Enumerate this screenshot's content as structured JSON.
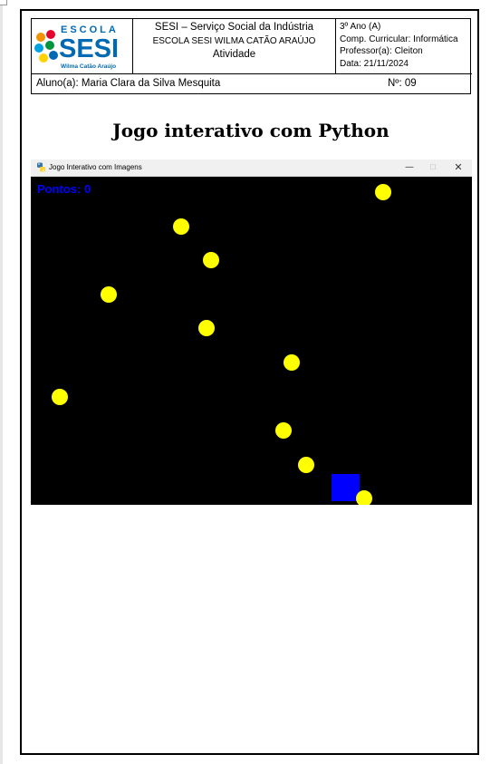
{
  "header": {
    "logo": {
      "brand_top": "ESCOLA",
      "brand_main": "SESI",
      "brand_sub": "Wilma Catão Araújo"
    },
    "institution": "SESI – Serviço Social da Indústria",
    "school": "ESCOLA SESI WILMA CATÃO ARAÚJO",
    "activity": "Atividade",
    "class": "3º Ano (A)",
    "subject": "Comp. Curricular: Informática",
    "teacher": "Professor(a): Cleiton",
    "date": "Data: 21/11/2024",
    "student": "Aluno(a): Maria Clara da Silva Mesquita",
    "number": "Nº: 09"
  },
  "document_title": "Jogo interativo com Python",
  "game_window": {
    "title": "Jogo Interativo com Imagens",
    "controls": {
      "minimize": "—",
      "maximize": "☐",
      "close": "✕"
    },
    "score_text": "Pontos: 0",
    "colors": {
      "background": "#000000",
      "ball": "#ffff00",
      "player": "#0000ff",
      "score": "#0000ff"
    }
  }
}
